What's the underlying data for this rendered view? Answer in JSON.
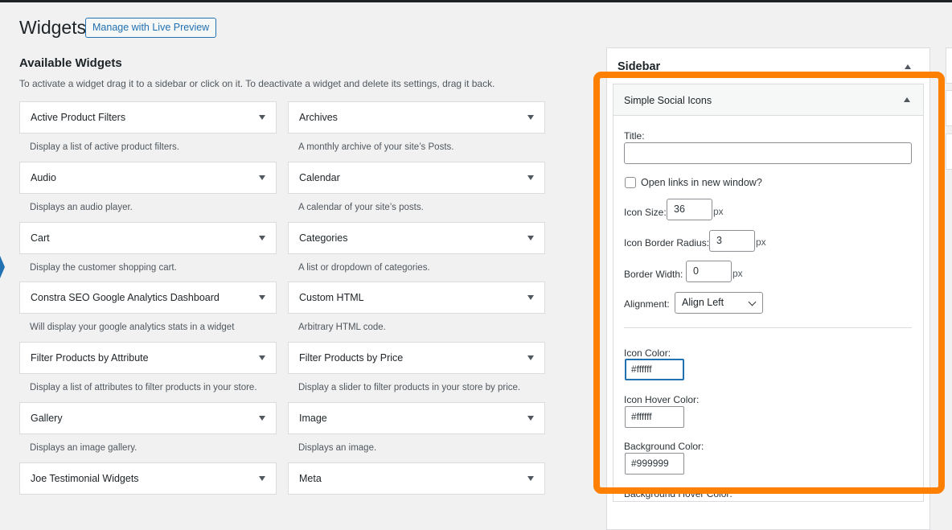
{
  "header": {
    "title": "Widgets",
    "live_preview_label": "Manage with Live Preview"
  },
  "available": {
    "title": "Available Widgets",
    "description": "To activate a widget drag it to a sidebar or click on it. To deactivate a widget and delete its settings, drag it back."
  },
  "widgets": [
    {
      "name": "Active Product Filters",
      "desc": "Display a list of active product filters."
    },
    {
      "name": "Archives",
      "desc": "A monthly archive of your site’s Posts."
    },
    {
      "name": "Audio",
      "desc": "Displays an audio player."
    },
    {
      "name": "Calendar",
      "desc": "A calendar of your site’s posts."
    },
    {
      "name": "Cart",
      "desc": "Display the customer shopping cart."
    },
    {
      "name": "Categories",
      "desc": "A list or dropdown of categories."
    },
    {
      "name": "Constra SEO Google Analytics Dashboard",
      "desc": "Will display your google analytics stats in a widget"
    },
    {
      "name": "Custom HTML",
      "desc": "Arbitrary HTML code."
    },
    {
      "name": "Filter Products by Attribute",
      "desc": "Display a list of attributes to filter products in your store."
    },
    {
      "name": "Filter Products by Price",
      "desc": "Display a slider to filter products in your store by price."
    },
    {
      "name": "Gallery",
      "desc": "Displays an image gallery."
    },
    {
      "name": "Image",
      "desc": "Displays an image."
    },
    {
      "name": "Joe Testimonial Widgets",
      "desc": ""
    },
    {
      "name": "Meta",
      "desc": ""
    }
  ],
  "sidebar": {
    "title": "Sidebar"
  },
  "simple_social_icons": {
    "title": "Simple Social Icons",
    "title_label": "Title:",
    "title_value": "",
    "new_window_label": "Open links in new window?",
    "new_window_checked": false,
    "icon_size_label": "Icon Size:",
    "icon_size_value": "36",
    "icon_border_radius_label": "Icon Border Radius:",
    "icon_border_radius_value": "3",
    "border_width_label": "Border Width:",
    "border_width_value": "0",
    "unit": "px",
    "alignment_label": "Alignment:",
    "alignment_value": "Align Left",
    "icon_color_label": "Icon Color:",
    "icon_color_value": "#ffffff",
    "icon_hover_color_label": "Icon Hover Color:",
    "icon_hover_color_value": "#ffffff",
    "background_color_label": "Background Color:",
    "background_color_value": "#999999",
    "background_hover_color_label": "Background Hover Color:"
  },
  "colors": {
    "accent": "#2271b1",
    "highlight": "#ff7f00"
  }
}
